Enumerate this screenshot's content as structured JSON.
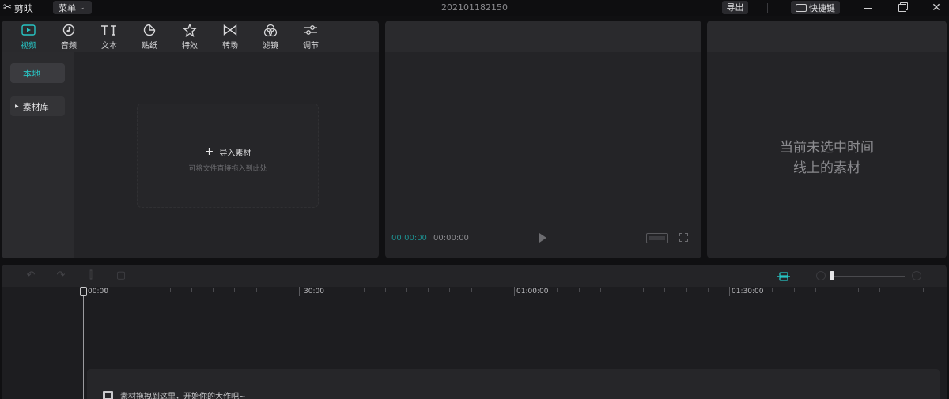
{
  "app": {
    "name": "剪映",
    "menu_label": "菜单",
    "project_title": "202101182150",
    "export_label": "导出",
    "shortcut_label": "快捷键"
  },
  "media_tabs": [
    {
      "label": "视频",
      "icon": "video-icon",
      "active": true
    },
    {
      "label": "音频",
      "icon": "audio-icon",
      "active": false
    },
    {
      "label": "文本",
      "icon": "text-icon",
      "active": false
    },
    {
      "label": "贴纸",
      "icon": "sticker-icon",
      "active": false
    },
    {
      "label": "特效",
      "icon": "effects-icon",
      "active": false
    },
    {
      "label": "转场",
      "icon": "transition-icon",
      "active": false
    },
    {
      "label": "滤镜",
      "icon": "filter-icon",
      "active": false
    },
    {
      "label": "调节",
      "icon": "adjust-icon",
      "active": false
    }
  ],
  "sidebar": {
    "local_label": "本地",
    "library_label": "素材库"
  },
  "import": {
    "title": "导入素材",
    "hint": "可将文件直接拖入到此处"
  },
  "player": {
    "current_time": "00:00:00",
    "total_time": "00:00:00"
  },
  "attributes": {
    "empty_line1": "当前未选中时间",
    "empty_line2": "线上的素材"
  },
  "timeline": {
    "ruler_labels": [
      "00:00",
      "30:00",
      "01:00:00",
      "01:30:00"
    ],
    "drop_hint": "素材拖拽到这里，开始你的大作吧~"
  },
  "colors": {
    "accent": "#27c4c4",
    "background": "#101012",
    "panel": "#242427"
  }
}
